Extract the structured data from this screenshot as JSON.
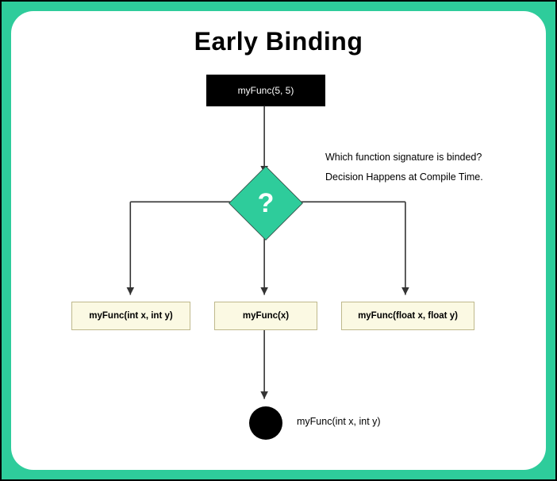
{
  "title": "Early Binding",
  "call": "myFunc(5, 5)",
  "decision_symbol": "?",
  "annotation": {
    "line1": "Which function signature is binded?",
    "line2": "Decision Happens at Compile Time."
  },
  "options": [
    "myFunc(int x, int y)",
    "myFunc(x)",
    "myFunc(float x, float y)"
  ],
  "result": "myFunc(int x, int y)"
}
